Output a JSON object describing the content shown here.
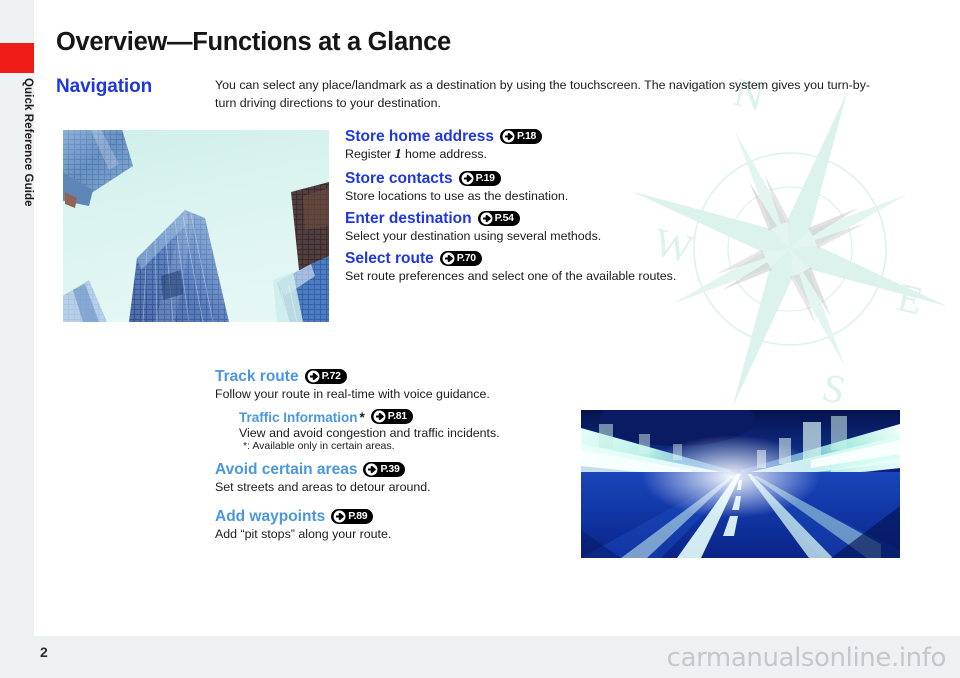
{
  "document": {
    "page_title": "Overview—Functions at a Glance",
    "page_number": "2",
    "side_tab_label": "Quick Reference Guide",
    "side_tab_color": "#EE1C15",
    "watermark": "carmanualsonline.info"
  },
  "section": {
    "title": "Navigation",
    "title_color": "#1F37E0",
    "intro": "You can select any place/landmark as a destination by using the touchscreen. The navigation system gives you turn-by-turn driving directions to your destination."
  },
  "compass": {
    "north": "N",
    "east": "E",
    "south": "S",
    "west": "W",
    "color": "#DDF2EC"
  },
  "images": {
    "building_photo_alt": "skyscrapers-photo",
    "tunnel_photo_alt": "tunnel-motion-blur-photo"
  },
  "top_group": [
    {
      "heading": "Store home address",
      "page_ref": "P.18",
      "desc_before": "Register ",
      "desc_emphasis": "1",
      "desc_after": " home address.",
      "color": "#1F37E0"
    },
    {
      "heading": "Store contacts",
      "page_ref": "P.19",
      "desc": "Store locations to use as the destination.",
      "color": "#1F37E0"
    },
    {
      "heading": "Enter destination",
      "page_ref": "P.54",
      "desc": "Select your destination using several methods.",
      "color": "#1F37E0"
    },
    {
      "heading": "Select route",
      "page_ref": "P.70",
      "desc": "Set route preferences and select one of the available routes.",
      "color": "#1F37E0"
    }
  ],
  "bottom_group": {
    "track_route": {
      "heading": "Track route",
      "page_ref": "P.72",
      "desc": "Follow your route in real-time with voice guidance.",
      "color": "#4B97DD"
    },
    "traffic_information": {
      "heading": "Traffic Information",
      "asterisk": "*",
      "page_ref": "P.81",
      "desc": "View and avoid congestion and traffic incidents.",
      "footnote": "*: Available only in certain areas.",
      "color": "#4B97DD"
    },
    "avoid_certain_areas": {
      "heading": "Avoid certain areas",
      "page_ref": "P.39",
      "desc": "Set streets and areas to detour around.",
      "color": "#4B97DD"
    },
    "add_waypoints": {
      "heading": "Add waypoints",
      "page_ref": "P.89",
      "desc": "Add “pit stops” along your route.",
      "color": "#4B97DD"
    }
  }
}
